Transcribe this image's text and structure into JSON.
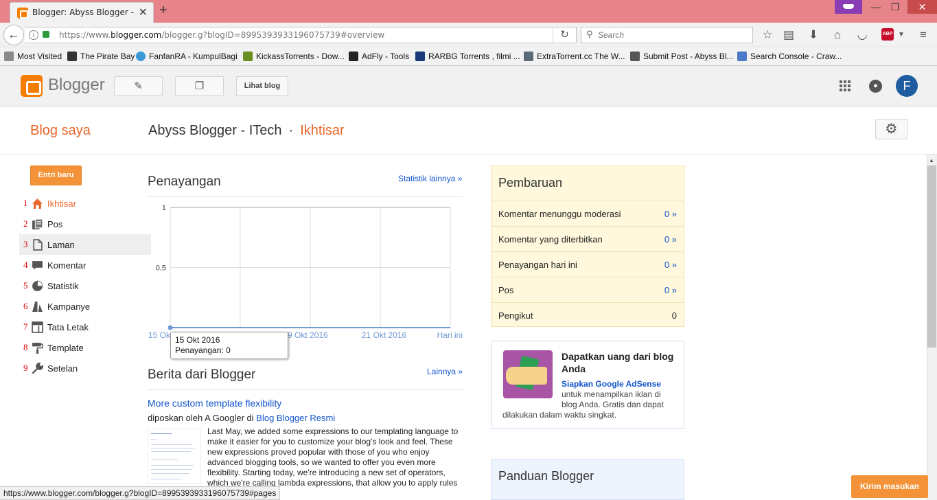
{
  "browser": {
    "tab_title": "Blogger: Abyss Blogger - I...",
    "url_prefix": "https://www.",
    "url_domain": "blogger.com",
    "url_rest": "/blogger.g?blogID=8995393933196075739#overview",
    "search_placeholder": "Search",
    "bookmarks": [
      {
        "label": "Most Visited",
        "color": "#7a7a7a"
      },
      {
        "label": "The Pirate Bay",
        "color": "#333333"
      },
      {
        "label": "FanfanRA - KumpulBagi",
        "color": "#3a9ad9"
      },
      {
        "label": "KickassTorrents - Dow...",
        "color": "#6b8e23"
      },
      {
        "label": "AdFly - Tools",
        "color": "#222222"
      },
      {
        "label": "RARBG Torrents , filmi ...",
        "color": "#1a3a7a"
      },
      {
        "label": "ExtraTorrent.cc The W...",
        "color": "#5a6a7a"
      },
      {
        "label": "Submit Post - Abyss Bl...",
        "color": "#555555"
      },
      {
        "label": "Search Console - Craw...",
        "color": "#4a7ac8"
      }
    ],
    "status_url": "https://www.blogger.com/blogger.g?blogID=8995393933196075739#pages"
  },
  "header": {
    "brand": "Blogger",
    "view_blog": "Lihat blog",
    "avatar_letter": "F"
  },
  "subheader": {
    "my_blogs": "Blog saya",
    "blog_name": "Abyss Blogger - ITech",
    "separator": "·",
    "current_page": "Ikhtisar"
  },
  "sidebar": {
    "new_post": "Entri baru",
    "items": [
      {
        "num": "1",
        "label": "Ikhtisar",
        "icon": "home-icon"
      },
      {
        "num": "2",
        "label": "Pos",
        "icon": "posts-icon"
      },
      {
        "num": "3",
        "label": "Laman",
        "icon": "page-icon"
      },
      {
        "num": "4",
        "label": "Komentar",
        "icon": "comment-icon"
      },
      {
        "num": "5",
        "label": "Statistik",
        "icon": "pie-chart-icon"
      },
      {
        "num": "6",
        "label": "Kampanye",
        "icon": "campaign-icon"
      },
      {
        "num": "7",
        "label": "Tata Letak",
        "icon": "layout-icon"
      },
      {
        "num": "8",
        "label": "Template",
        "icon": "paint-roller-icon"
      },
      {
        "num": "9",
        "label": "Setelan",
        "icon": "wrench-icon"
      }
    ]
  },
  "views": {
    "title": "Penayangan",
    "more_link": "Statistik lainnya »",
    "tooltip_date": "15 Okt 2016",
    "tooltip_value": "Penayangan: 0"
  },
  "chart_data": {
    "type": "line",
    "x_tick_labels": [
      "15 Okt",
      "17 Okt 2016",
      "19 Okt 2016",
      "21 Okt 2016",
      "Hari ini"
    ],
    "y_tick_labels": [
      "1",
      "0.5"
    ],
    "ylim": [
      0,
      1
    ],
    "series": [
      {
        "values": [
          0,
          0,
          0,
          0,
          0,
          0,
          0,
          0
        ],
        "color": "#6f9ad3"
      }
    ],
    "grid": true
  },
  "news": {
    "title": "Berita dari Blogger",
    "more_link": "Lainnya »",
    "post_title": "More custom template flexibility",
    "post_by_prefix": "diposkan oleh A Googler di",
    "post_blog": "Blog Blogger Resmi",
    "post_body": "Last May, we added some expressions to our templating language to make it easier for you to customize your blog's look and feel. These new expressions proved popular with those of you who enjoy advanced blogging tools, so we wanted to offer you even more flexibility. Starting today, we're introducing a new set of operators, which we're calling lambda expressions, that allow you to apply rules ..."
  },
  "updates": {
    "title": "Pembaruan",
    "rows": [
      {
        "label": "Komentar menunggu moderasi",
        "value": "0 »"
      },
      {
        "label": "Komentar yang diterbitkan",
        "value": "0 »"
      },
      {
        "label": "Penayangan hari ini",
        "value": "0 »"
      },
      {
        "label": "Pos",
        "value": "0 »"
      },
      {
        "label": "Pengikut",
        "value": "0"
      }
    ]
  },
  "adsense": {
    "title": "Dapatkan uang dari blog Anda",
    "link": "Siapkan Google AdSense",
    "text_a": "untuk menampilkan iklan di blog Anda. Gratis dan dapat",
    "text_b": "dilakukan dalam waktu singkat."
  },
  "guide": {
    "title": "Panduan Blogger"
  },
  "feedback": {
    "label": "Kirim masukan"
  }
}
